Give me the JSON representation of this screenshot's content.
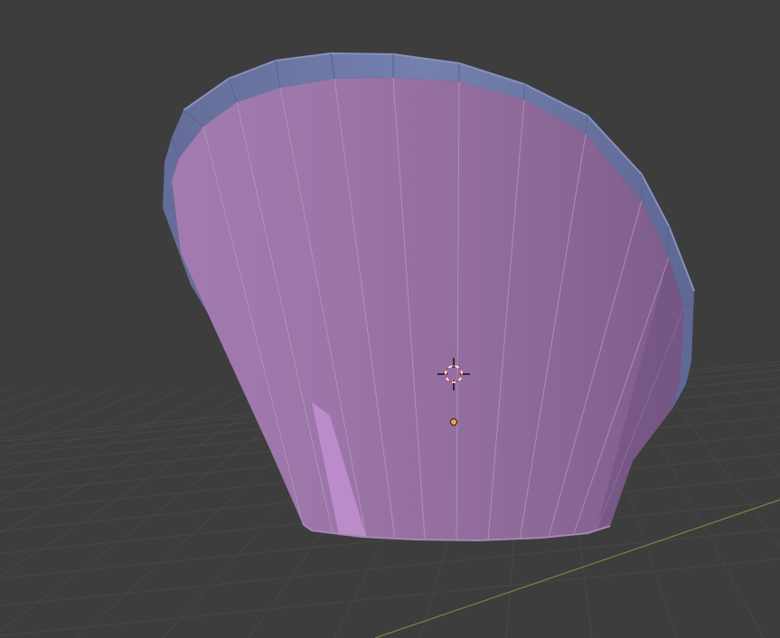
{
  "viewport": {
    "background_color": "#3d3d3d",
    "grid_color": "#474747",
    "x_axis_color": "#6e8c3c",
    "mesh": {
      "inner_color": "#9a73a3",
      "inner_highlight_color": "#c48fd0",
      "rim_color": "#6f7aa8",
      "edge_color": "#b69bbf"
    },
    "icons": [
      "3d-cursor-icon",
      "origin-point-icon"
    ]
  }
}
